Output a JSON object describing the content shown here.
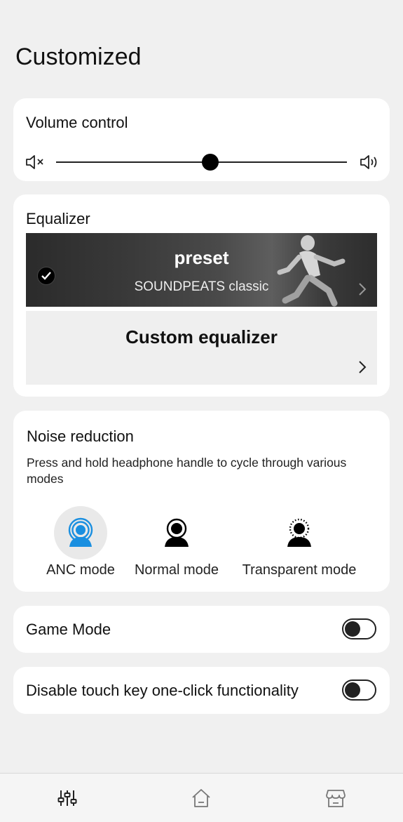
{
  "page": {
    "title": "Customized"
  },
  "volume": {
    "title": "Volume control",
    "level": 0.53,
    "mute_icon": "volume-mute-icon",
    "loud_icon": "volume-up-icon"
  },
  "equalizer": {
    "title": "Equalizer",
    "preset": {
      "title": "preset",
      "subtitle": "SOUNDPEATS classic",
      "selected": true
    },
    "custom": {
      "title": "Custom equalizer"
    }
  },
  "noise_reduction": {
    "title": "Noise reduction",
    "description": "Press and hold headphone handle to cycle through various modes",
    "active_color": "#1a8fe0",
    "modes": [
      {
        "label": "ANC mode",
        "icon": "anc-icon",
        "active": true
      },
      {
        "label": "Normal mode",
        "icon": "normal-mode-icon",
        "active": false
      },
      {
        "label": "Transparent mode",
        "icon": "transparent-mode-icon",
        "active": false
      }
    ]
  },
  "game_mode": {
    "label": "Game Mode",
    "enabled": false
  },
  "touch_key": {
    "label": "Disable touch key one-click functionality",
    "enabled": false
  },
  "bottom_nav": [
    {
      "icon": "equalizer-sliders-icon",
      "active": true
    },
    {
      "icon": "home-icon",
      "active": false
    },
    {
      "icon": "store-icon",
      "active": false
    }
  ]
}
